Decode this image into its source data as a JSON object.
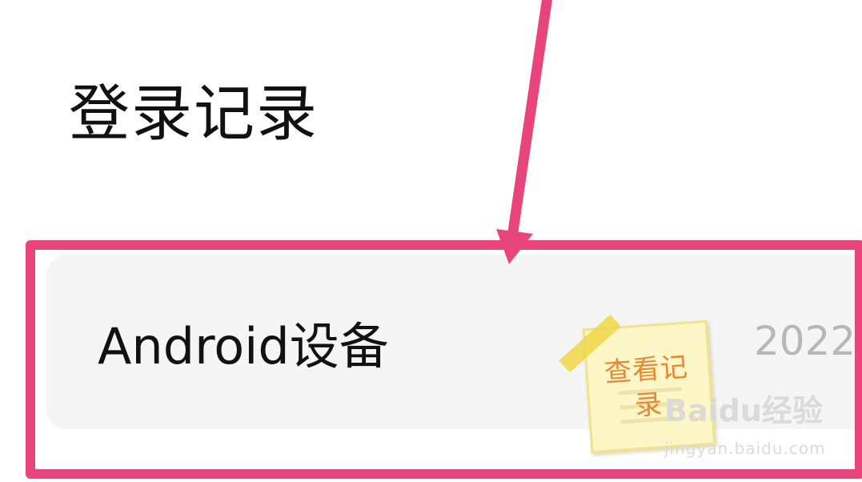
{
  "page": {
    "title": "登录记录"
  },
  "record": {
    "device": "Android设备",
    "date": "2022"
  },
  "annotation": {
    "note": "查看记录",
    "highlight_color": "#e8457c",
    "note_text_color": "#e48a36"
  },
  "watermark": {
    "brand": "Baidu经验",
    "url": "jingyan.baidu.com"
  }
}
